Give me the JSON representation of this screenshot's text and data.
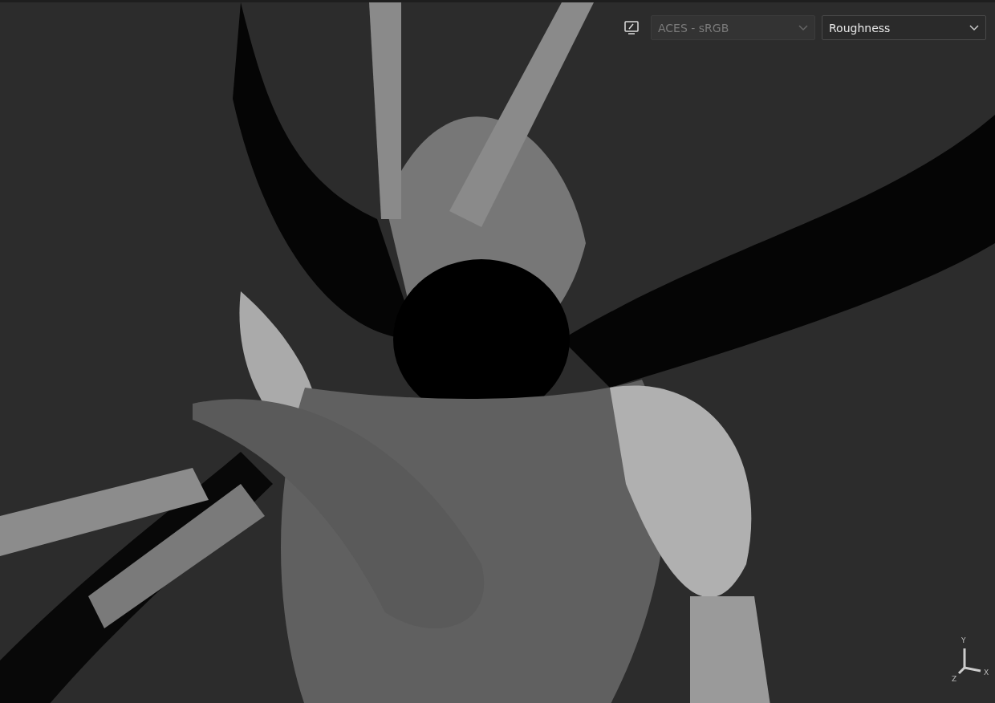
{
  "viewport": {
    "toolbar": {
      "dropdowns": [
        {
          "value": "ACES - sRGB",
          "disabled": true
        },
        {
          "value": "Roughness",
          "disabled": false
        }
      ]
    },
    "axis_gizmo": {
      "labels": [
        "Y",
        "Z",
        "X"
      ]
    }
  }
}
